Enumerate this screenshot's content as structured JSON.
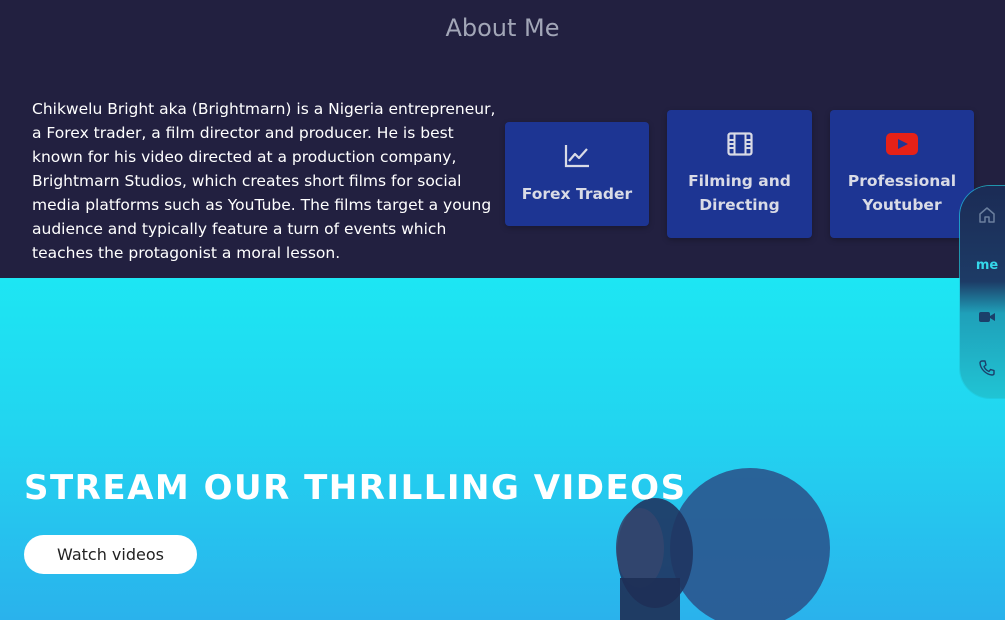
{
  "about": {
    "title": "About Me",
    "bio": "Chikwelu Bright aka (Brightmarn) is a Nigeria entrepreneur, a Forex trader, a film director and producer. He is best known for his video directed at a production company, Brightmarn Studios, which creates short films for social media platforms such as YouTube. The films target a young audience and typically feature a turn of events which teaches the protagonist a moral lesson.",
    "cards": [
      {
        "label": "Forex Trader",
        "icon": "line-chart-icon"
      },
      {
        "label": "Filming and Directing",
        "icon": "film-icon"
      },
      {
        "label": "Professional Youtuber",
        "icon": "youtube-icon"
      }
    ]
  },
  "hero": {
    "title": "STREAM OUR THRILLING VIDEOS",
    "button_label": "Watch videos"
  },
  "sidenav": {
    "items": [
      {
        "icon": "home-icon"
      },
      {
        "label": "me"
      },
      {
        "icon": "video-camera-icon"
      },
      {
        "icon": "phone-icon"
      }
    ]
  },
  "colors": {
    "background": "#222040",
    "card": "#1d3593",
    "hero_top": "#1de6f3",
    "hero_bottom": "#2ab2ec",
    "youtube_red": "#e62117"
  }
}
